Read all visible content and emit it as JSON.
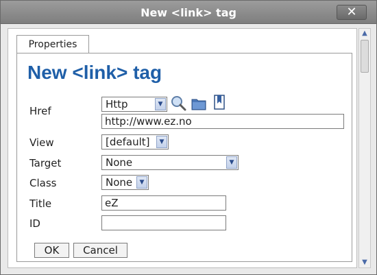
{
  "window": {
    "title": "New <link> tag",
    "close_glyph": "✕"
  },
  "tab": {
    "label": "Properties"
  },
  "panel": {
    "heading": "New <link> tag"
  },
  "form": {
    "href": {
      "label": "Href",
      "protocol": "Http",
      "url": "http://www.ez.no"
    },
    "view": {
      "label": "View",
      "value": "[default]"
    },
    "target": {
      "label": "Target",
      "value": "None"
    },
    "class": {
      "label": "Class",
      "value": "None"
    },
    "title": {
      "label": "Title",
      "value": "eZ"
    },
    "id": {
      "label": "ID",
      "value": ""
    }
  },
  "buttons": {
    "ok": "OK",
    "cancel": "Cancel"
  },
  "icons": {
    "search": "magnifier-icon",
    "browse": "folder-icon",
    "bookmarks": "bookmark-icon"
  },
  "colors": {
    "heading": "#1f5fa8",
    "titlebar": "#8a8a8a"
  }
}
